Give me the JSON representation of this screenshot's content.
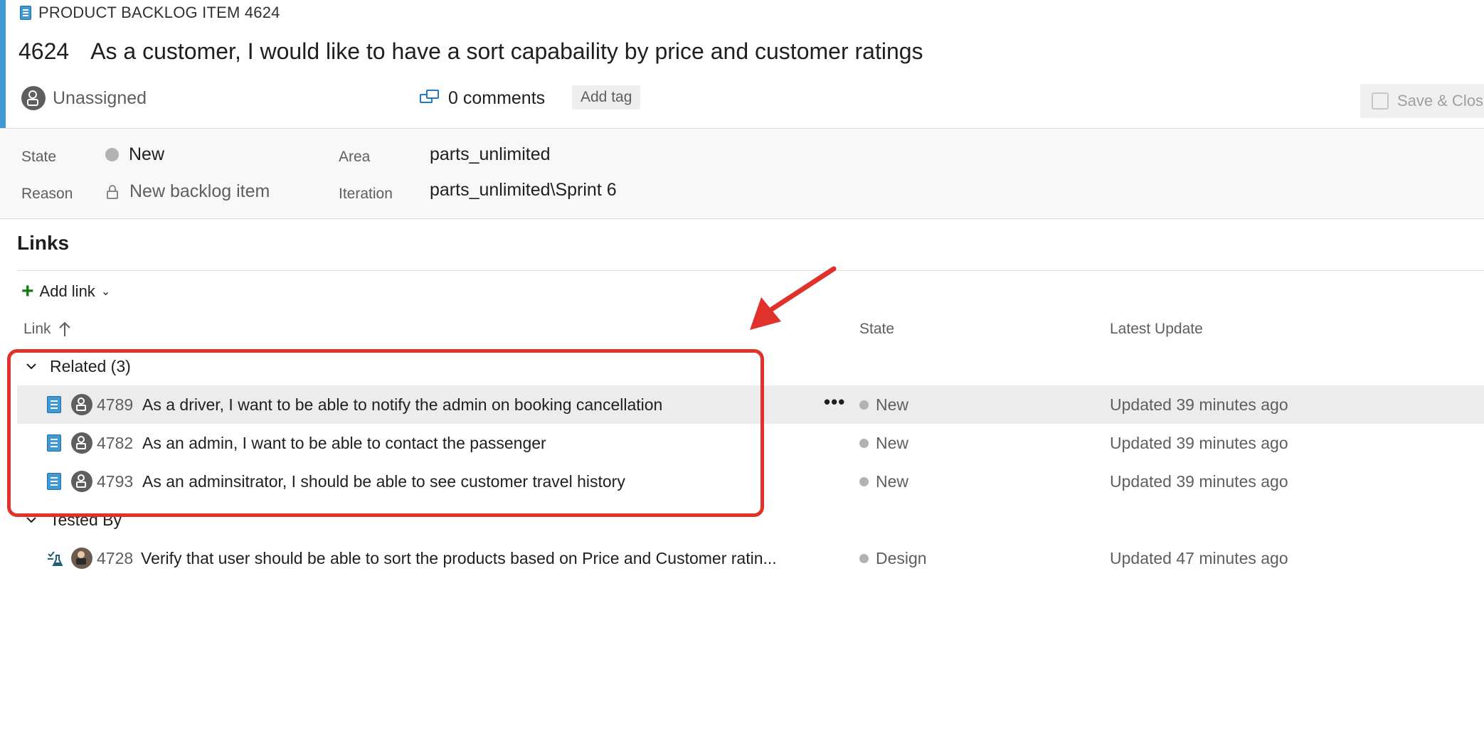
{
  "header": {
    "type_label": "PRODUCT BACKLOG ITEM 4624",
    "id": "4624",
    "title": "As a customer, I would like to have a sort capabaility by price and customer ratings",
    "assignee": "Unassigned",
    "comments": "0 comments",
    "add_tag": "Add tag",
    "save_close": "Save & Clos"
  },
  "fields": {
    "state_label": "State",
    "state_value": "New",
    "reason_label": "Reason",
    "reason_value": "New backlog item",
    "area_label": "Area",
    "area_value": "parts_unlimited",
    "iteration_label": "Iteration",
    "iteration_value": "parts_unlimited\\Sprint 6"
  },
  "links": {
    "title": "Links",
    "add_link": "Add link",
    "columns": {
      "link": "Link",
      "state": "State",
      "latest_update": "Latest Update"
    },
    "groups": [
      {
        "name": "Related (3)",
        "rows": [
          {
            "id": "4789",
            "title": "As a driver, I want to be able to notify the admin on booking cancellation",
            "state": "New",
            "updated": "Updated 39 minutes ago"
          },
          {
            "id": "4782",
            "title": "As an admin, I want to be able to contact the passenger",
            "state": "New",
            "updated": "Updated 39 minutes ago"
          },
          {
            "id": "4793",
            "title": "As an adminsitrator, I should be able to see customer travel history",
            "state": "New",
            "updated": "Updated 39 minutes ago"
          }
        ]
      },
      {
        "name": "Tested By",
        "rows": [
          {
            "id": "4728",
            "title": "Verify that user should be able to sort the products based on Price and Customer ratin...",
            "state": "Design",
            "updated": "Updated 47 minutes ago"
          }
        ]
      }
    ],
    "more_label": "•••"
  },
  "colors": {
    "accent": "#3f9ad4",
    "annotation": "#e0322b",
    "state_dot": "#b2b2b2",
    "add_green": "#107c10"
  },
  "icons": [
    "backlog-item-icon",
    "avatar-icon",
    "comments-icon",
    "save-icon",
    "lock-icon",
    "plus-icon",
    "chevron-down-icon",
    "sort-up-icon",
    "test-case-icon",
    "more-icon",
    "arrow-annotation"
  ]
}
